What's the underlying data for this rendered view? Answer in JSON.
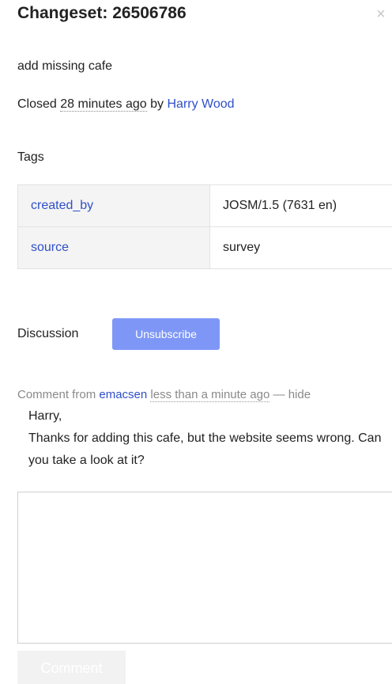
{
  "changeset": {
    "title_prefix": "Changeset: ",
    "id": "26506786",
    "close_glyph": "×",
    "comment": "add missing cafe",
    "status": "Closed",
    "closed_time": "28 minutes ago",
    "by_label": "by",
    "author": "Harry Wood"
  },
  "tags": {
    "heading": "Tags",
    "rows": [
      {
        "key": "created_by",
        "value": "JOSM/1.5 (7631 en)"
      },
      {
        "key": "source",
        "value": "survey"
      }
    ]
  },
  "discussion": {
    "heading": "Discussion",
    "unsubscribe_label": "Unsubscribe",
    "comments": [
      {
        "from_label": "Comment from",
        "user": "emacsen",
        "time": "less than a minute ago",
        "separator": "—",
        "hide_label": "hide",
        "lines": [
          "Harry,",
          "Thanks for adding this cafe, but the website seems wrong. Can you take a look at it?"
        ]
      }
    ],
    "new_comment_value": "",
    "comment_button_label": "Comment"
  },
  "colors": {
    "link": "#2f4fc8",
    "button_accent": "#7e97f7",
    "muted_text": "#8a8a8a"
  },
  "icons": {
    "close": "close-icon"
  }
}
